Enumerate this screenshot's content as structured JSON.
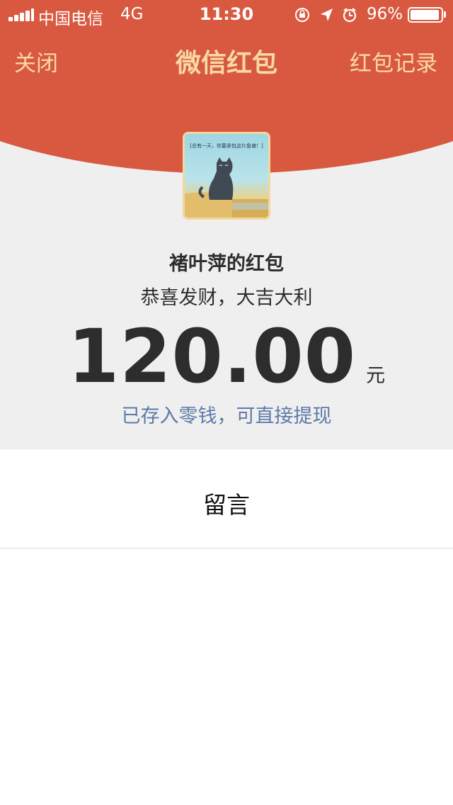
{
  "status_bar": {
    "carrier": "中国电信",
    "network": "4G",
    "time": "11:30",
    "battery": "96%",
    "battery_level": 0.96
  },
  "nav": {
    "close": "关闭",
    "title": "微信红包",
    "records": "红包记录"
  },
  "avatar": {
    "caption": "[总有一天，你要承包这片鱼塘！]"
  },
  "packet": {
    "sender": "褚叶萍的红包",
    "blessing": "恭喜发财，大吉大利",
    "amount": "120.00",
    "unit": "元",
    "saved_note": "已存入零钱，可直接提现"
  },
  "message": {
    "label": "留言"
  },
  "colors": {
    "header_red": "#d95940",
    "gold_text": "#f8d9a6",
    "link_blue": "#5d7aa8",
    "background_gray": "#efefef"
  }
}
